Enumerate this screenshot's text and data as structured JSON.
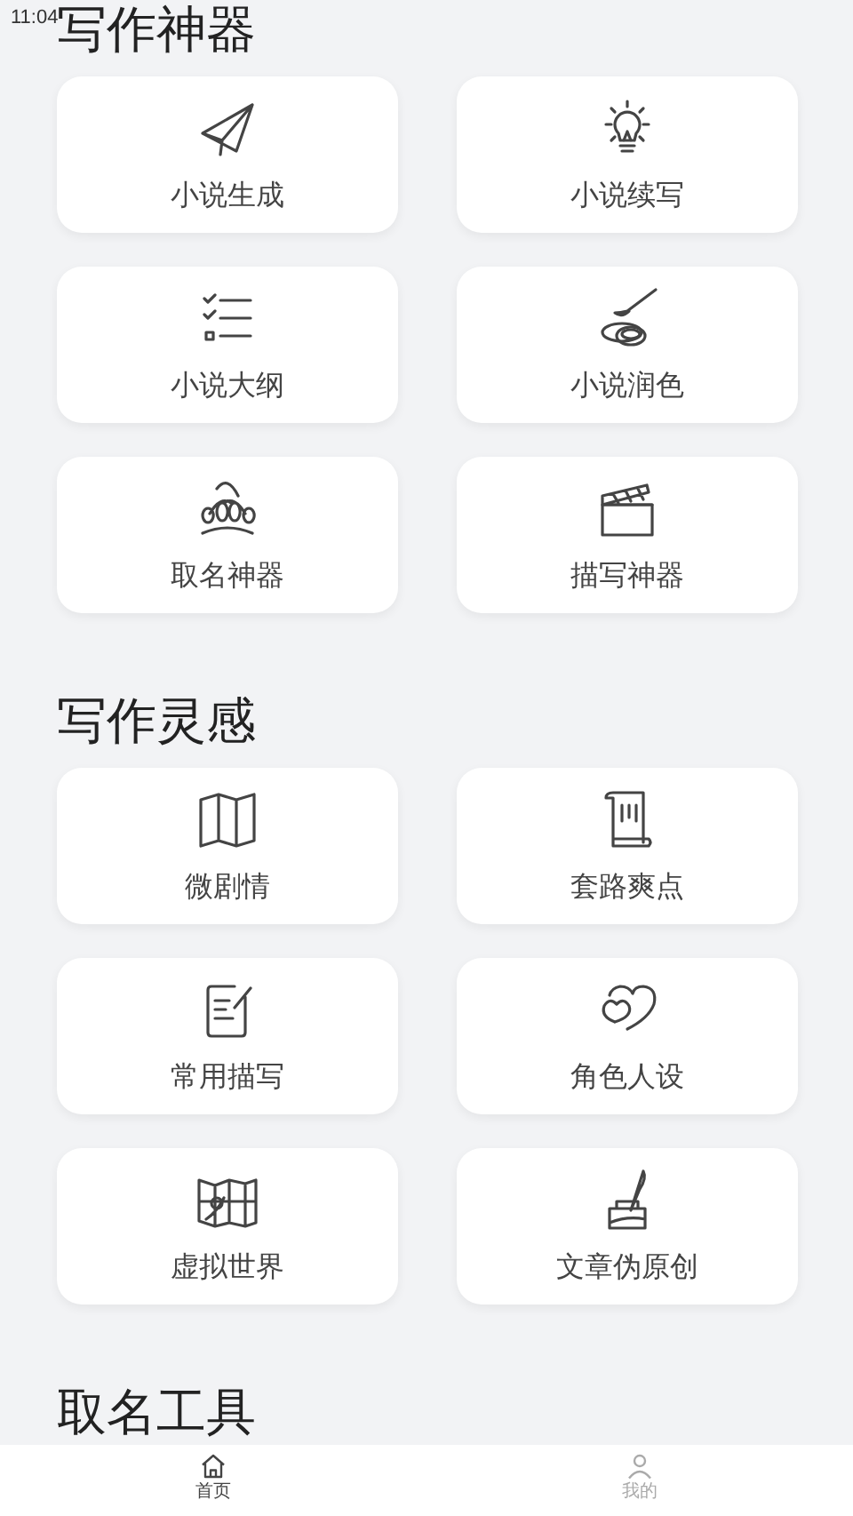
{
  "status_bar": {
    "time": "11:04"
  },
  "sections": [
    {
      "title": "写作神器",
      "tools": [
        {
          "label": "小说生成"
        },
        {
          "label": "小说续写"
        },
        {
          "label": "小说大纲"
        },
        {
          "label": "小说润色"
        },
        {
          "label": "取名神器"
        },
        {
          "label": "描写神器"
        }
      ]
    },
    {
      "title": "写作灵感",
      "tools": [
        {
          "label": "微剧情"
        },
        {
          "label": "套路爽点"
        },
        {
          "label": "常用描写"
        },
        {
          "label": "角色人设"
        },
        {
          "label": "虚拟世界"
        },
        {
          "label": "文章伪原创"
        }
      ]
    },
    {
      "title": "取名工具"
    }
  ],
  "bottom_nav": [
    {
      "label": "首页",
      "selected": true
    },
    {
      "label": "我的",
      "selected": false
    }
  ]
}
